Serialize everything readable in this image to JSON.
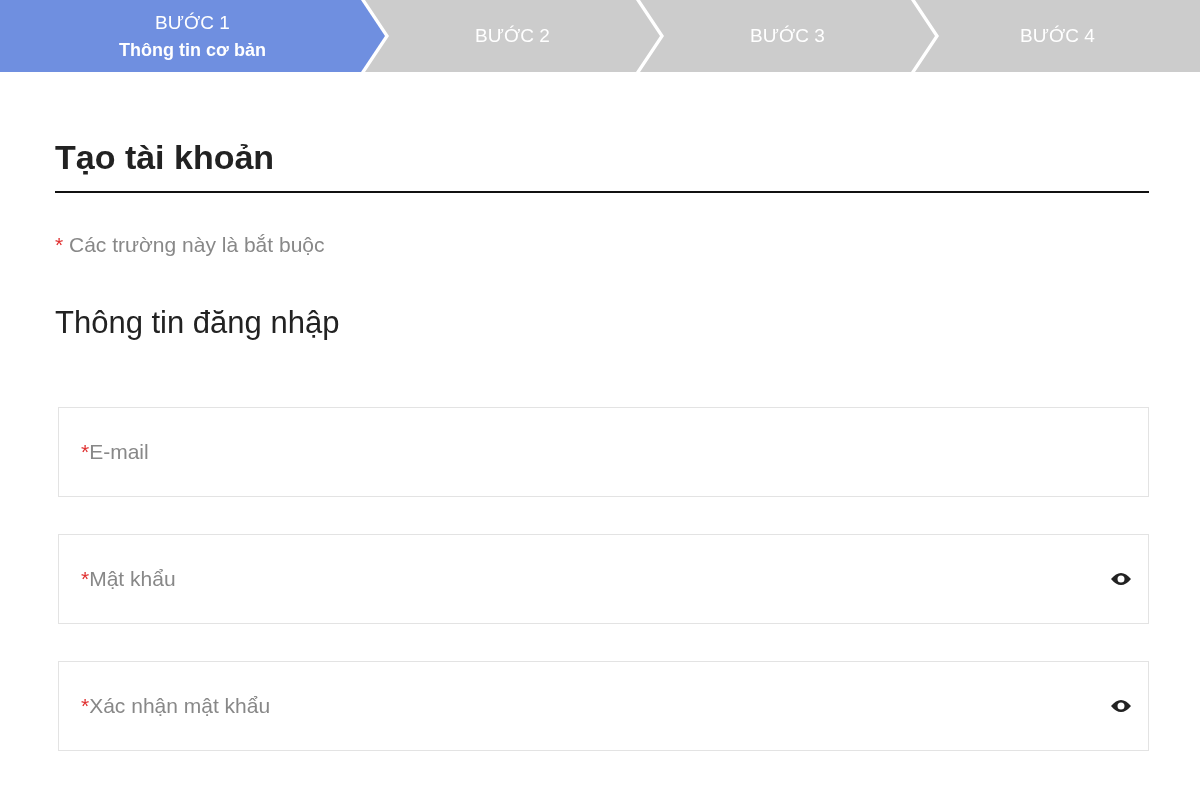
{
  "steps": [
    {
      "label": "BƯỚC 1",
      "sublabel": "Thông tin cơ bản",
      "selected": true
    },
    {
      "label": "BƯỚC 2",
      "selected": false
    },
    {
      "label": "BƯỚC 3",
      "selected": false
    },
    {
      "label": "BƯỚC 4",
      "selected": false
    }
  ],
  "title": "Tạo tài khoản",
  "required_note": {
    "mark": "*",
    "text": "Các trường này là bắt buộc"
  },
  "section_title": "Thông tin đăng nhập",
  "fields": [
    {
      "kind": "text",
      "mark": "*",
      "placeholder": "E-mail"
    },
    {
      "kind": "password",
      "mark": "*",
      "placeholder": "Mật khẩu"
    },
    {
      "kind": "password",
      "mark": "*",
      "placeholder": "Xác nhận mật khẩu"
    }
  ]
}
